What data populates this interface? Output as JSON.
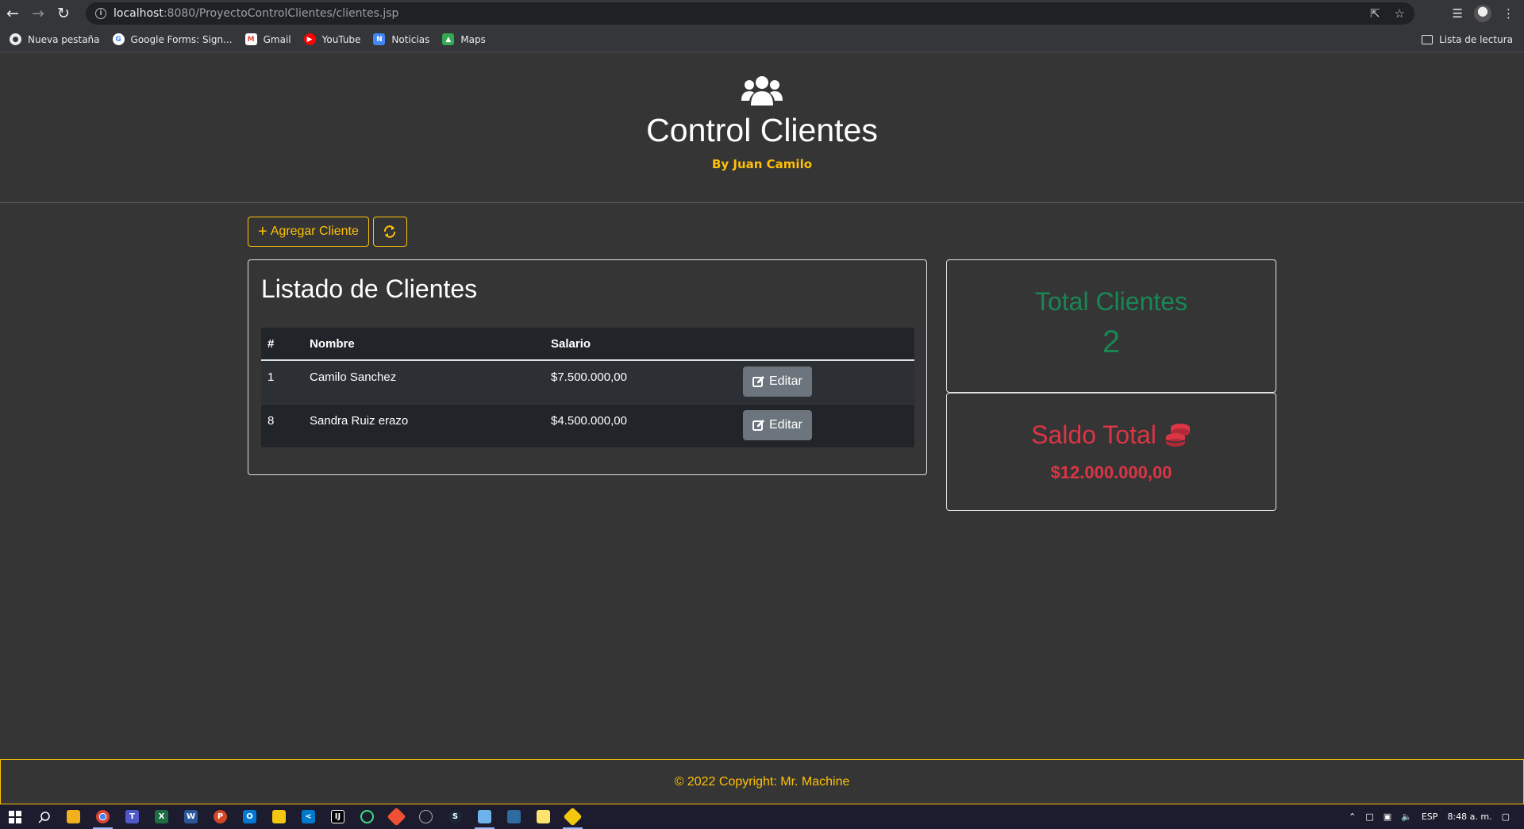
{
  "browser": {
    "url_host": "localhost",
    "url_path": ":8080/ProyectoControlClientes/clientes.jsp",
    "bookmarks": [
      {
        "label": "Nueva pestaña",
        "icon": "chrome-icon",
        "color": "#e8eaed"
      },
      {
        "label": "Google Forms: Sign...",
        "icon": "google-icon",
        "color": "#ffffff"
      },
      {
        "label": "Gmail",
        "icon": "gmail-icon",
        "color": "#ea4335"
      },
      {
        "label": "YouTube",
        "icon": "youtube-icon",
        "color": "#ff0000"
      },
      {
        "label": "Noticias",
        "icon": "news-icon",
        "color": "#4285f4"
      },
      {
        "label": "Maps",
        "icon": "maps-icon",
        "color": "#34a853"
      }
    ],
    "reading_list": "Lista de lectura"
  },
  "header": {
    "title": "Control Clientes",
    "subtitle": "By Juan Camilo"
  },
  "actions": {
    "add_label": "Agregar Cliente"
  },
  "list": {
    "title": "Listado de Clientes",
    "columns": [
      "#",
      "Nombre",
      "Salario",
      ""
    ],
    "rows": [
      {
        "id": "1",
        "nombre": "Camilo Sanchez",
        "salario": "$7.500.000,00",
        "action": "Editar"
      },
      {
        "id": "8",
        "nombre": "Sandra Ruiz erazo",
        "salario": "$4.500.000,00",
        "action": "Editar"
      }
    ]
  },
  "stats": {
    "total_clientes_label": "Total Clientes",
    "total_clientes_value": "2",
    "saldo_total_label": "Saldo Total",
    "saldo_total_value": "$12.000.000,00"
  },
  "footer": {
    "copyright": "© 2022 Copyright: Mr. Machine"
  },
  "taskbar": {
    "language": "ESP",
    "time": "8:48 a. m."
  },
  "colors": {
    "accent": "#ffc107",
    "success": "#198754",
    "danger": "#dc3545",
    "secondary": "#6c757d",
    "background": "#353535"
  }
}
